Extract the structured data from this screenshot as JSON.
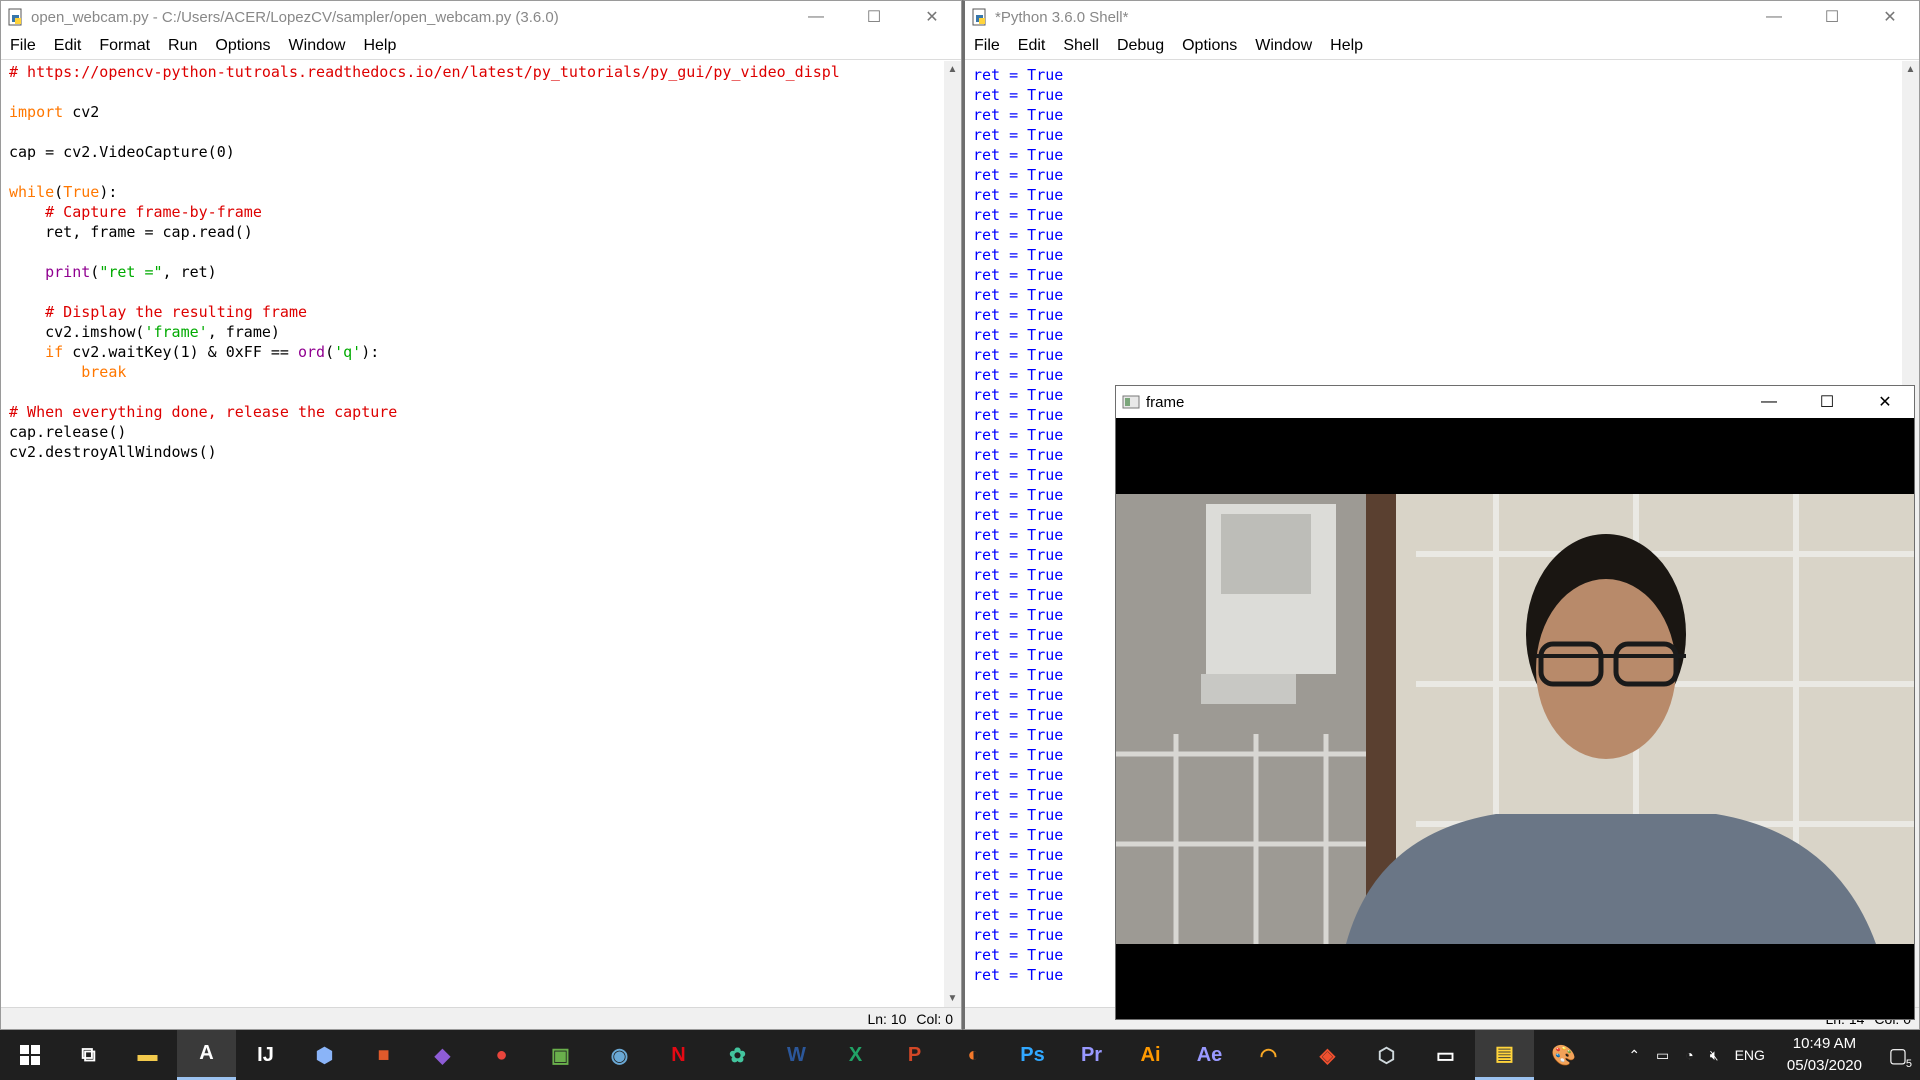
{
  "editor": {
    "title": "open_webcam.py - C:/Users/ACER/LopezCV/sampler/open_webcam.py (3.6.0)",
    "menu": [
      "File",
      "Edit",
      "Format",
      "Run",
      "Options",
      "Window",
      "Help"
    ],
    "code": [
      {
        "type": "com",
        "text": "# https://opencv-python-tutroals.readthedocs.io/en/latest/py_tutorials/py_gui/py_video_displ"
      },
      {
        "type": "blank",
        "text": ""
      },
      {
        "type": "mixed",
        "parts": [
          [
            "kw",
            "import"
          ],
          [
            "def",
            " cv2"
          ]
        ]
      },
      {
        "type": "blank",
        "text": ""
      },
      {
        "type": "def",
        "text": "cap = cv2.VideoCapture(0)"
      },
      {
        "type": "blank",
        "text": ""
      },
      {
        "type": "mixed",
        "parts": [
          [
            "kw",
            "while"
          ],
          [
            "def",
            "("
          ],
          [
            "kw",
            "True"
          ],
          [
            "def",
            "):"
          ]
        ]
      },
      {
        "type": "mixed",
        "parts": [
          [
            "def",
            "    "
          ],
          [
            "com",
            "# Capture frame-by-frame"
          ]
        ]
      },
      {
        "type": "def",
        "text": "    ret, frame = cap.read()"
      },
      {
        "type": "blank",
        "text": ""
      },
      {
        "type": "mixed",
        "parts": [
          [
            "def",
            "    "
          ],
          [
            "bi",
            "print"
          ],
          [
            "def",
            "("
          ],
          [
            "str",
            "\"ret =\""
          ],
          [
            "def",
            ", ret)"
          ]
        ]
      },
      {
        "type": "blank",
        "text": ""
      },
      {
        "type": "mixed",
        "parts": [
          [
            "def",
            "    "
          ],
          [
            "com",
            "# Display the resulting frame"
          ]
        ]
      },
      {
        "type": "mixed",
        "parts": [
          [
            "def",
            "    cv2.imshow("
          ],
          [
            "str",
            "'frame'"
          ],
          [
            "def",
            ", frame)"
          ]
        ]
      },
      {
        "type": "mixed",
        "parts": [
          [
            "def",
            "    "
          ],
          [
            "kw",
            "if"
          ],
          [
            "def",
            " cv2.waitKey(1) & 0xFF == "
          ],
          [
            "bi",
            "ord"
          ],
          [
            "def",
            "("
          ],
          [
            "str",
            "'q'"
          ],
          [
            "def",
            "):"
          ]
        ]
      },
      {
        "type": "mixed",
        "parts": [
          [
            "def",
            "        "
          ],
          [
            "kw",
            "break"
          ]
        ]
      },
      {
        "type": "blank",
        "text": ""
      },
      {
        "type": "com",
        "text": "# When everything done, release the capture"
      },
      {
        "type": "def",
        "text": "cap.release()"
      },
      {
        "type": "def",
        "text": "cv2.destroyAllWindows()"
      }
    ],
    "status_ln": "Ln: 10",
    "status_col": "Col: 0"
  },
  "shell": {
    "title": "*Python 3.6.0 Shell*",
    "menu": [
      "File",
      "Edit",
      "Shell",
      "Debug",
      "Options",
      "Window",
      "Help"
    ],
    "output_line": "ret = True",
    "output_count": 46,
    "status_ln": "Ln: 14",
    "status_col": "Col: 0"
  },
  "frame_window": {
    "title": "frame"
  },
  "window_controls": {
    "minimize": "—",
    "maximize": "☐",
    "close": "✕"
  },
  "taskbar": {
    "apps": [
      {
        "name": "task-view",
        "glyph": "⧉",
        "color": "#ffffff"
      },
      {
        "name": "file-explorer",
        "glyph": "▬",
        "color": "#f2c94c"
      },
      {
        "name": "acrobat",
        "glyph": "A",
        "color": "#ffffff",
        "active": true
      },
      {
        "name": "intellij",
        "glyph": "IJ",
        "color": "#ffffff"
      },
      {
        "name": "3d-viewer",
        "glyph": "⬢",
        "color": "#8ab4f8"
      },
      {
        "name": "office",
        "glyph": "■",
        "color": "#e05a2b"
      },
      {
        "name": "visual-studio",
        "glyph": "◆",
        "color": "#8e5cd6"
      },
      {
        "name": "chrome",
        "glyph": "●",
        "color": "#e8453c"
      },
      {
        "name": "image-editor",
        "glyph": "▣",
        "color": "#6ab04c"
      },
      {
        "name": "steam",
        "glyph": "◉",
        "color": "#6aa9d6"
      },
      {
        "name": "netflix",
        "glyph": "N",
        "color": "#e50914"
      },
      {
        "name": "chat-app",
        "glyph": "✿",
        "color": "#43c59e"
      },
      {
        "name": "word",
        "glyph": "W",
        "color": "#2b579a"
      },
      {
        "name": "excel",
        "glyph": "X",
        "color": "#21a366"
      },
      {
        "name": "powerpoint",
        "glyph": "P",
        "color": "#d24726"
      },
      {
        "name": "blender",
        "glyph": "◐",
        "color": "#f5792a"
      },
      {
        "name": "photoshop",
        "glyph": "Ps",
        "color": "#31a8ff"
      },
      {
        "name": "premiere",
        "glyph": "Pr",
        "color": "#9999ff"
      },
      {
        "name": "illustrator",
        "glyph": "Ai",
        "color": "#ff9a00"
      },
      {
        "name": "after-effects",
        "glyph": "Ae",
        "color": "#9999ff"
      },
      {
        "name": "audio-app",
        "glyph": "◠",
        "color": "#f9a825"
      },
      {
        "name": "git-app",
        "glyph": "◈",
        "color": "#f1502f"
      },
      {
        "name": "virtualbox",
        "glyph": "⬡",
        "color": "#cfd8dc"
      },
      {
        "name": "terminal",
        "glyph": "▭",
        "color": "#ffffff"
      },
      {
        "name": "idle",
        "glyph": "▤",
        "color": "#ffd43b",
        "active": true
      },
      {
        "name": "paint",
        "glyph": "🎨",
        "color": "#ffffff"
      }
    ],
    "tray": {
      "language": "ENG",
      "time": "10:49 AM",
      "date": "05/03/2020",
      "notifications": "5"
    }
  }
}
